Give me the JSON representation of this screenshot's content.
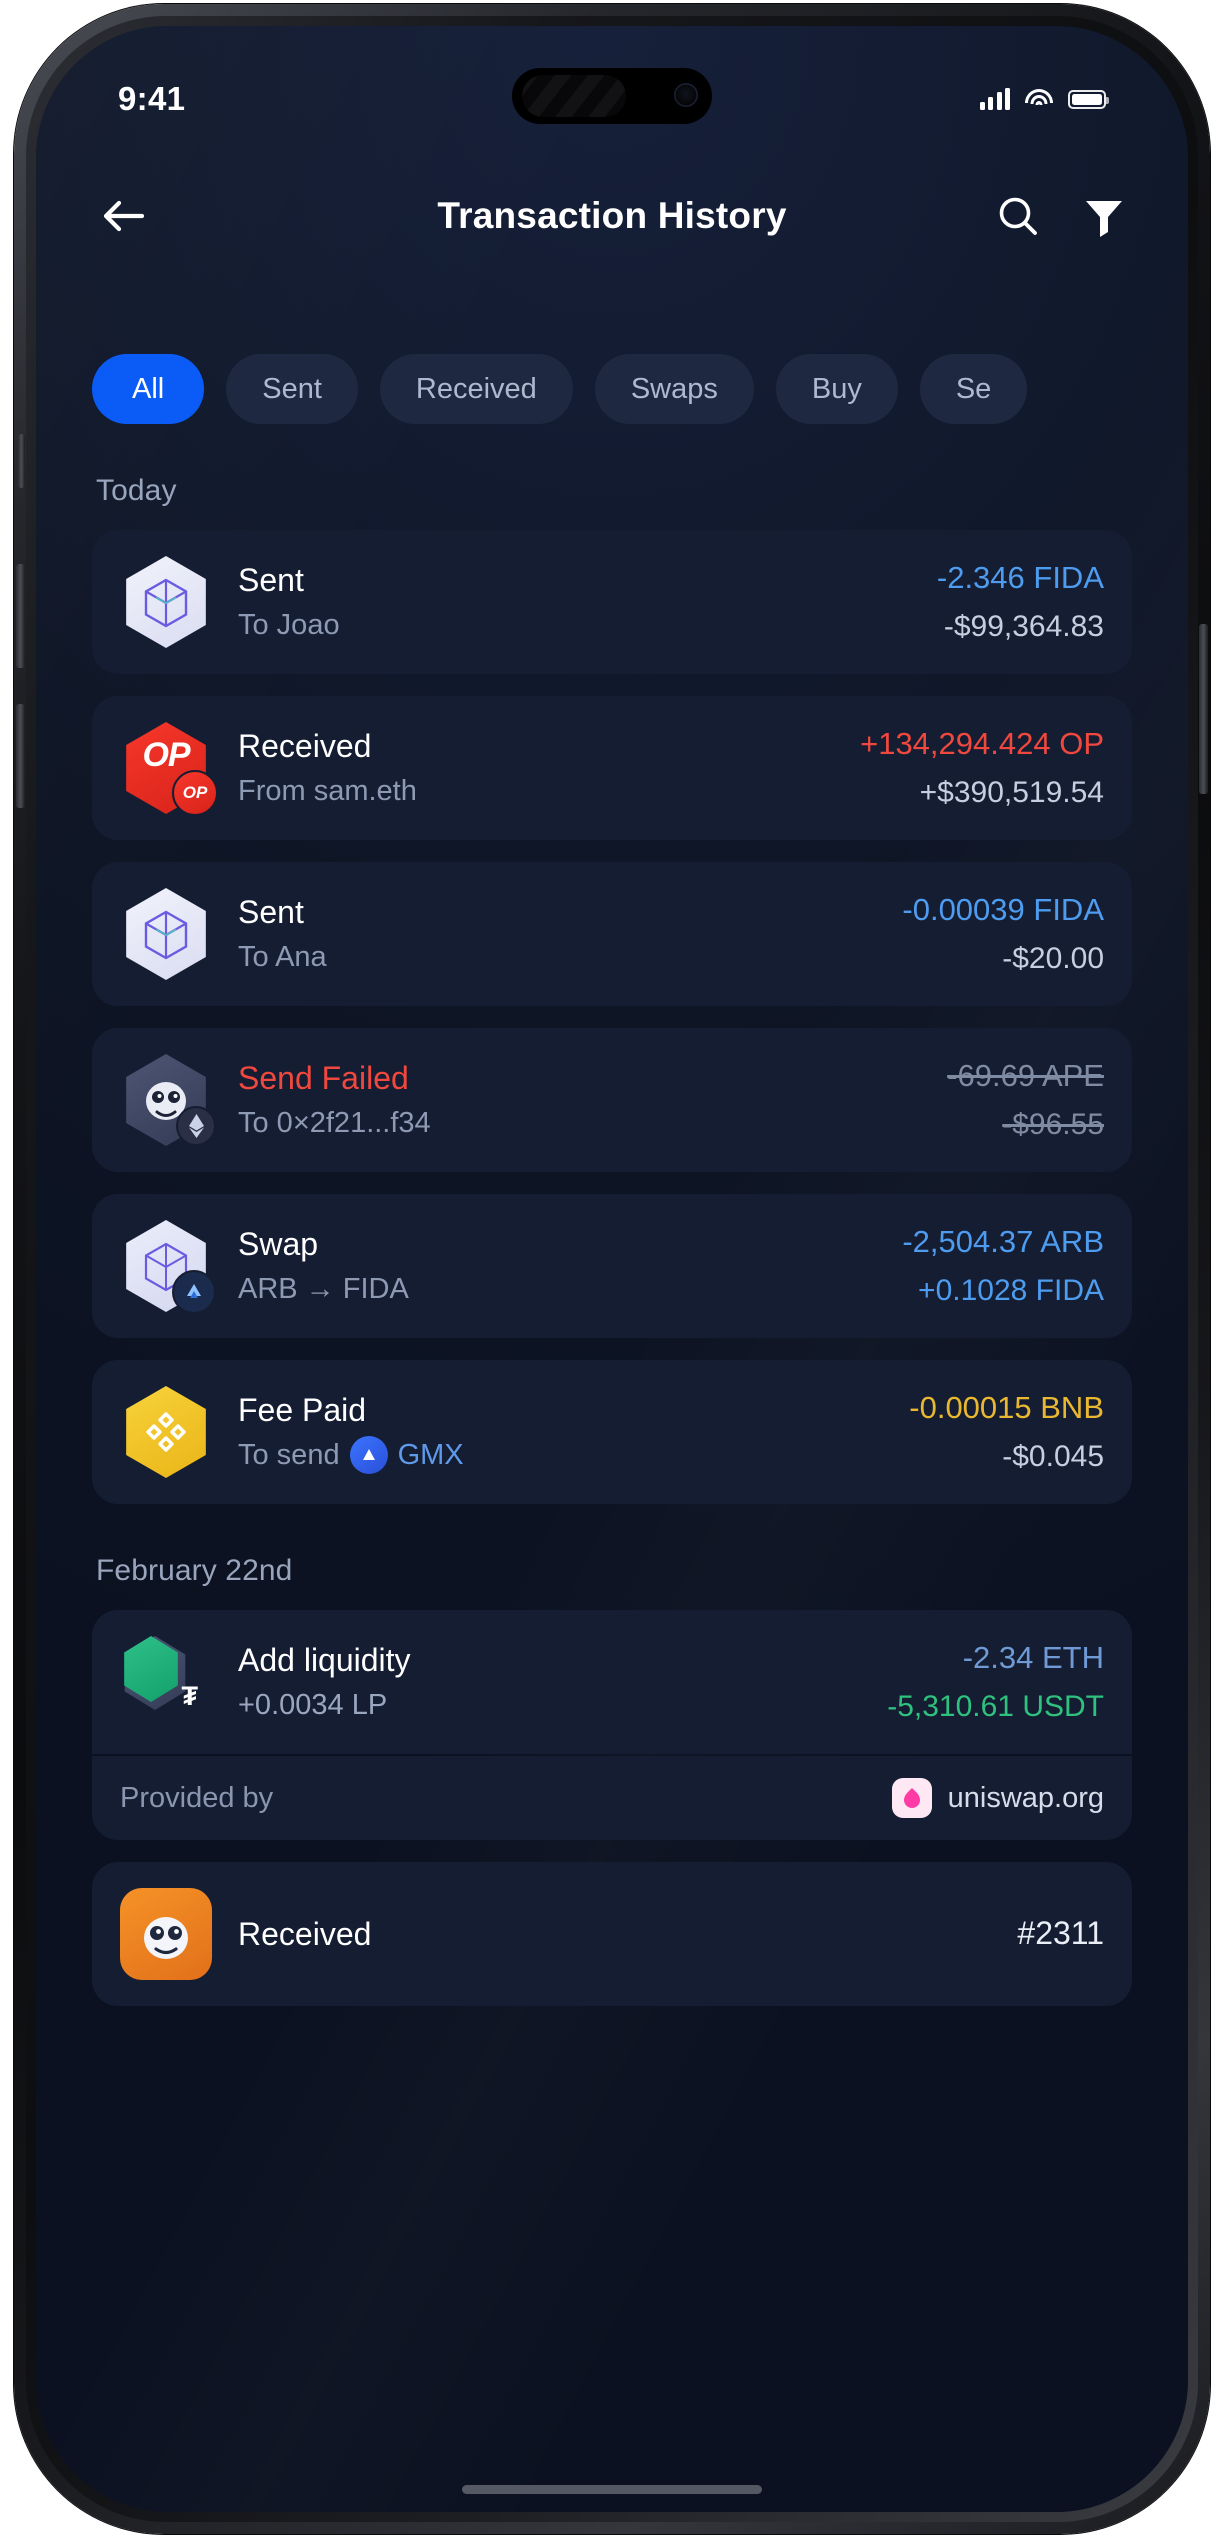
{
  "status": {
    "time": "9:41",
    "signal_icon": "cellular-bars-icon",
    "wifi_icon": "wifi-icon",
    "battery_icon": "battery-icon"
  },
  "header": {
    "title": "Transaction History",
    "back_icon": "arrow-left-icon",
    "search_icon": "search-icon",
    "filter_icon": "funnel-filter-icon"
  },
  "filters": [
    {
      "label": "All",
      "active": true
    },
    {
      "label": "Sent",
      "active": false
    },
    {
      "label": "Received",
      "active": false
    },
    {
      "label": "Swaps",
      "active": false
    },
    {
      "label": "Buy",
      "active": false
    },
    {
      "label": "Se",
      "active": false
    }
  ],
  "sections": [
    {
      "title": "Today",
      "items": [
        {
          "title": "Sent",
          "subtitle": "To Joao",
          "amount": "-2.346 FIDA",
          "fiat": "-$99,364.83",
          "amount_color": "#4d9cf0",
          "fiat_color": "#c6cfe0",
          "icon": "fida-token-icon"
        },
        {
          "title": "Received",
          "subtitle": "From sam.eth",
          "amount": "+134,294.424 OP",
          "fiat": "+$390,519.54",
          "amount_color": "#f0483e",
          "fiat_color": "#c6cfe0",
          "icon": "optimism-token-icon"
        },
        {
          "title": "Sent",
          "subtitle": "To Ana",
          "amount": "-0.00039 FIDA",
          "fiat": "-$20.00",
          "amount_color": "#4d9cf0",
          "fiat_color": "#c6cfe0",
          "icon": "fida-token-icon"
        },
        {
          "title": "Send Failed",
          "subtitle": "To 0×2f21...f34",
          "amount": "-69.69 APE",
          "fiat": "-$96.55",
          "amount_color": "#7f8aa3",
          "fiat_color": "#7f8aa3",
          "icon": "apecoin-token-icon",
          "failed": true
        },
        {
          "title": "Swap",
          "subtitle": "ARB → FIDA",
          "amount": "-2,504.37 ARB",
          "fiat": "+0.1028 FIDA",
          "amount_color": "#4d9cf0",
          "fiat_color": "#4d9cf0",
          "icon": "arbitrum-token-icon"
        },
        {
          "title": "Fee Paid",
          "subtitle": "To send",
          "subtitle_tag": "GMX",
          "amount": "-0.00015 BNB",
          "fiat": "-$0.045",
          "amount_color": "#e9b830",
          "fiat_color": "#c6cfe0",
          "icon": "bnb-token-icon",
          "tag_icon": "gmx-token-icon"
        }
      ]
    },
    {
      "title": "February 22nd",
      "items": [
        {
          "title": "Add liquidity",
          "subtitle": "+0.0034 LP",
          "amount": "-2.34 ETH",
          "fiat": "-5,310.61 USDT",
          "amount_color": "#6f9ad6",
          "fiat_color": "#2ec27e",
          "icon": "eth-usdt-pair-icon",
          "provided_by_label": "Provided by",
          "provided_by_value": "uniswap.org",
          "provider_icon": "uniswap-icon"
        },
        {
          "title": "Received",
          "subtitle": "",
          "amount": "#2311",
          "fiat": "",
          "amount_color": "#eaeef7",
          "fiat_color": "#c6cfe0",
          "icon": "nft-collection-icon"
        }
      ]
    }
  ],
  "colors": {
    "accent": "#0b5cf6",
    "screen_bg": "#0e1525",
    "card_bg": "#151d32",
    "chip_bg": "#1e2840",
    "text_primary": "#ffffff",
    "text_secondary": "#8e9ab4",
    "danger": "#f0483e",
    "success": "#2ec27e",
    "blue_amount": "#4d9cf0",
    "yellow_amount": "#e9b830"
  }
}
